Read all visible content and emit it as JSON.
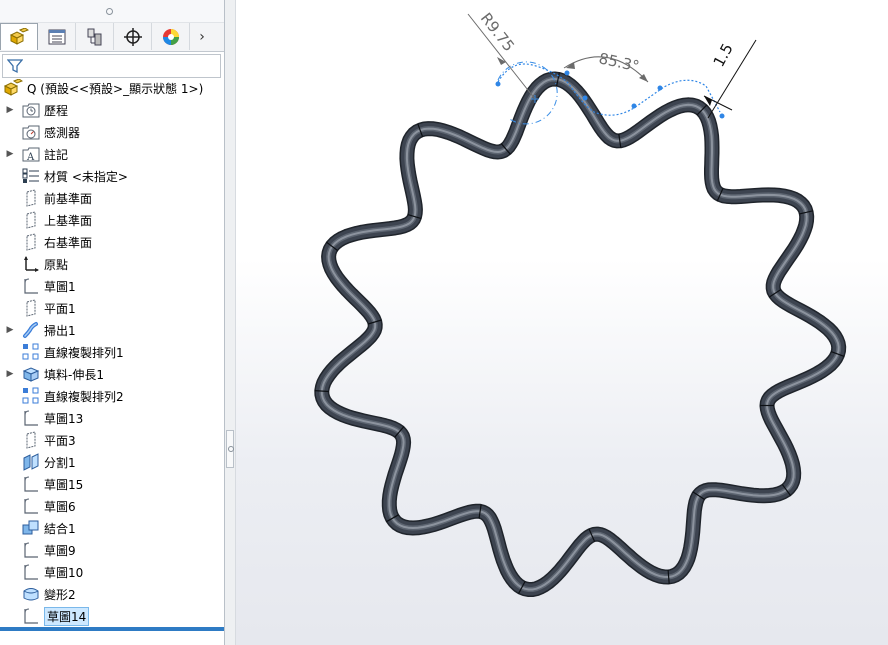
{
  "feature_manager": {
    "tabs": [
      {
        "name": "part-tab",
        "icon": "part-icon"
      },
      {
        "name": "property-tab",
        "icon": "property-manager-icon"
      },
      {
        "name": "config-tab",
        "icon": "configuration-manager-icon"
      },
      {
        "name": "dimxpert-tab",
        "icon": "crosshair-icon"
      },
      {
        "name": "display-tab",
        "icon": "display-manager-icon"
      }
    ],
    "root_label": "Q  (預設<<預設>_顯示狀態 1>)",
    "items": [
      {
        "label": "歷程",
        "icon": "history-folder-icon",
        "expandable": true
      },
      {
        "label": "感測器",
        "icon": "sensor-folder-icon",
        "expandable": false
      },
      {
        "label": "註記",
        "icon": "annotation-folder-icon",
        "expandable": true
      },
      {
        "label": "材質 <未指定>",
        "icon": "material-icon",
        "expandable": false
      },
      {
        "label": "前基準面",
        "icon": "plane-icon",
        "expandable": false
      },
      {
        "label": "上基準面",
        "icon": "plane-icon",
        "expandable": false
      },
      {
        "label": "右基準面",
        "icon": "plane-icon",
        "expandable": false
      },
      {
        "label": "原點",
        "icon": "origin-icon",
        "expandable": false
      },
      {
        "label": "草圖1",
        "icon": "sketch-icon",
        "expandable": false
      },
      {
        "label": "平面1",
        "icon": "plane-icon",
        "expandable": false
      },
      {
        "label": "掃出1",
        "icon": "sweep-icon",
        "expandable": true
      },
      {
        "label": "直線複製排列1",
        "icon": "linear-pattern-icon",
        "expandable": false
      },
      {
        "label": "填料-伸長1",
        "icon": "extrude-icon",
        "expandable": true
      },
      {
        "label": "直線複製排列2",
        "icon": "linear-pattern-icon",
        "expandable": false
      },
      {
        "label": "草圖13",
        "icon": "sketch-icon",
        "expandable": false
      },
      {
        "label": "平面3",
        "icon": "plane-icon",
        "expandable": false
      },
      {
        "label": "分割1",
        "icon": "split-icon",
        "expandable": false
      },
      {
        "label": "草圖15",
        "icon": "sketch-icon",
        "expandable": false
      },
      {
        "label": "草圖6",
        "icon": "sketch-icon",
        "expandable": false
      },
      {
        "label": "結合1",
        "icon": "combine-icon",
        "expandable": false
      },
      {
        "label": "草圖9",
        "icon": "sketch-icon",
        "expandable": false
      },
      {
        "label": "草圖10",
        "icon": "sketch-icon",
        "expandable": false
      },
      {
        "label": "變形2",
        "icon": "deform-icon",
        "expandable": false
      },
      {
        "label": "草圖14",
        "icon": "sketch-icon",
        "expandable": false,
        "selected": true
      }
    ]
  },
  "viewport": {
    "dimensions": {
      "radius": "R9.75",
      "angle": "85.3°",
      "thickness": "1.5"
    },
    "colors": {
      "ring": "#3d4450",
      "ring_highlight": "#8c939e",
      "dimension": "#6b6b6b",
      "sketch": "#3a8ee6"
    }
  }
}
